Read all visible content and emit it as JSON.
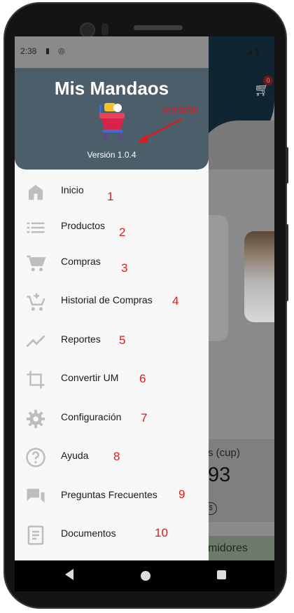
{
  "status_bar": {
    "time": "2:38"
  },
  "background_app": {
    "cart_badge": "0",
    "panel_title": "s (cup)",
    "panel_value": "93",
    "panel_currency": "$",
    "green_button": "midores"
  },
  "drawer": {
    "app_title": "Mis Mandaos",
    "version": "Versión 1.0.4",
    "annotation": "versión",
    "items": [
      {
        "label": "Inicio",
        "icon": "home-icon",
        "num": "1"
      },
      {
        "label": "Productos",
        "icon": "list-icon",
        "num": "2"
      },
      {
        "label": "Compras",
        "icon": "shopping-cart-icon",
        "num": "3"
      },
      {
        "label": "Historial de Compras",
        "icon": "cart-plus-icon",
        "num": "4"
      },
      {
        "label": "Reportes",
        "icon": "trending-up-icon",
        "num": "5"
      },
      {
        "label": "Convertir UM",
        "icon": "crop-icon",
        "num": "6"
      },
      {
        "label": "Configuración",
        "icon": "gear-icon",
        "num": "7"
      },
      {
        "label": "Ayuda",
        "icon": "help-circle-icon",
        "num": "8"
      },
      {
        "label": "Preguntas Frecuentes",
        "icon": "forum-icon",
        "num": "9"
      },
      {
        "label": "Documentos",
        "icon": "document-icon",
        "num": "10"
      }
    ]
  },
  "colors": {
    "drawer_header": "#4b5e69",
    "annotation": "#e01a1a",
    "icon_gray": "#bdbdbd"
  }
}
